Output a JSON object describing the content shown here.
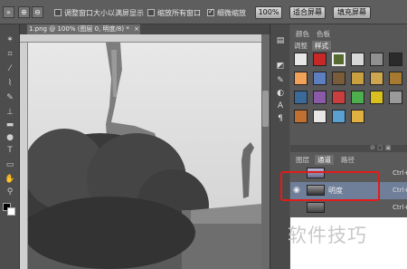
{
  "options_bar": {
    "fit_window_label": "调整窗口大小以满屏显示",
    "zoom_all_label": "缩放所有窗口",
    "scrubby_zoom_label": "细微缩放",
    "zoom_100_label": "100%",
    "fit_screen_label": "适合屏幕",
    "fill_screen_label": "填充屏幕",
    "scrubby_checked": true
  },
  "document": {
    "tab_title": "1.png @ 100% (图层 0, 明度/8) *",
    "close_label": "×"
  },
  "side_icons": [
    "palette-icon",
    "swatch-icon",
    "brush-icon",
    "adjust-icon",
    "text-a-icon",
    "paragraph-icon"
  ],
  "panels": {
    "top_tabs": [
      "颜色",
      "色板"
    ],
    "sub_tabs": [
      "调整",
      "样式"
    ],
    "active_sub_tab": "样式",
    "style_swatches": [
      "#e7e7e7",
      "#c62828",
      "#556b2f",
      "#d7d7d7",
      "#909090",
      "#2b2b2b",
      "#f2a15a",
      "#5d7fbf",
      "#7a5b3a",
      "#c8a040",
      "#cfa650",
      "#a67a30",
      "#3a6a9a",
      "#8a5aa8",
      "#c93e3e",
      "#4cae4c",
      "#d9c020",
      "#9a9a9a",
      "#c07030",
      "#e6e6e6",
      "#5aa0d0",
      "#e0b040"
    ]
  },
  "layers": {
    "tabs": [
      "图层",
      "通道",
      "路径"
    ],
    "active_tab": "通道",
    "rows": [
      {
        "name": "",
        "shortcut": "Ctrl+",
        "selected": false
      },
      {
        "name": "明度",
        "shortcut": "Ctrl+",
        "selected": true
      },
      {
        "name": "",
        "shortcut": "Ctrl+",
        "selected": false
      }
    ]
  },
  "watermark": "软件技巧",
  "colors": {
    "highlight": "#e21b1b",
    "selected_row": "#6f7f9a"
  }
}
